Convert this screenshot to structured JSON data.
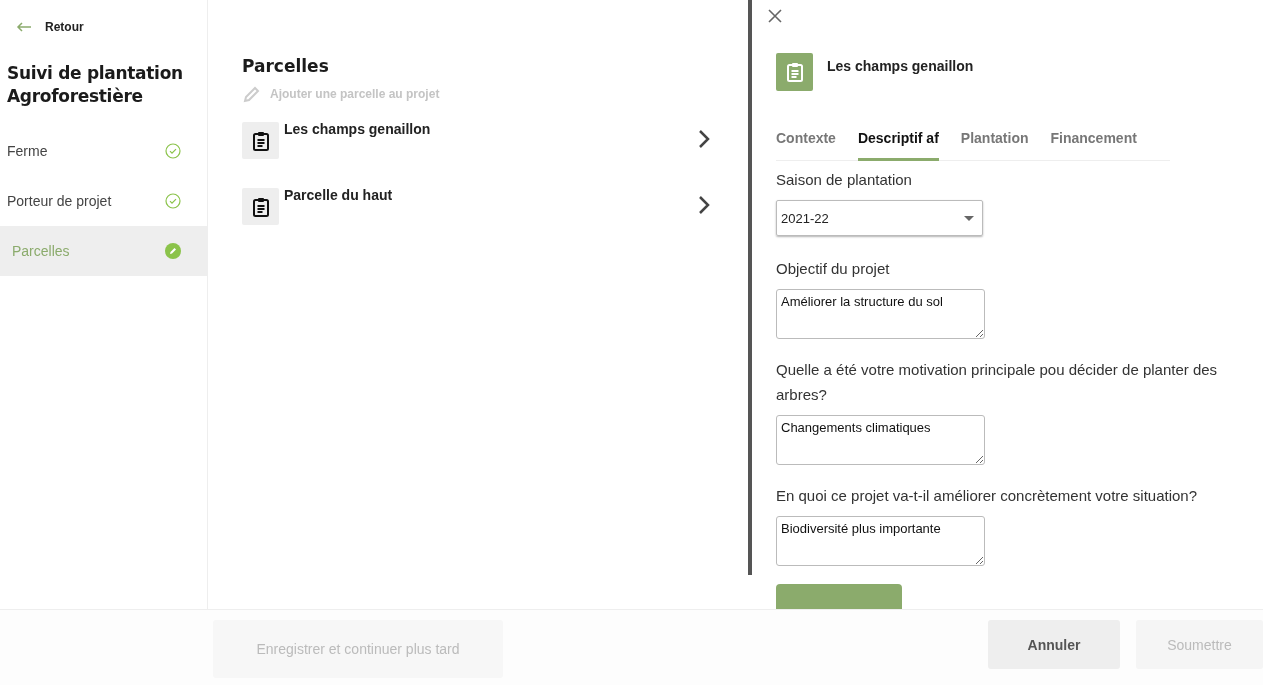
{
  "sidebar": {
    "back": "Retour",
    "title": "Suivi de plantation Agroforestière",
    "items": [
      {
        "label": "Ferme",
        "kind": "done",
        "selected": false
      },
      {
        "label": "Porteur de projet",
        "kind": "done",
        "selected": false
      },
      {
        "label": "Parcelles",
        "kind": "editing",
        "selected": true
      }
    ]
  },
  "parcels": {
    "title": "Parcelles",
    "add": "Ajouter une parcelle au projet",
    "items": [
      {
        "name": "Les champs genaillon"
      },
      {
        "name": "Parcelle du haut"
      }
    ]
  },
  "panel": {
    "title": "Les champs genaillon",
    "tabs": [
      {
        "label": "Contexte",
        "selected": false
      },
      {
        "label": "Descriptif af",
        "selected": true
      },
      {
        "label": "Plantation",
        "selected": false
      },
      {
        "label": "Financement",
        "selected": false
      }
    ],
    "fields": [
      {
        "kind": "select",
        "label": "Saison de plantation",
        "value": "2021-22"
      },
      {
        "kind": "textarea",
        "label": "Objectif du projet",
        "value": "Améliorer la structure du sol"
      },
      {
        "kind": "textarea",
        "label": "Quelle a été votre motivation principale pou décider de planter des arbres?",
        "value": "Changements climatiques"
      },
      {
        "kind": "textarea",
        "label": "En quoi ce projet va-t-il améliorer concrètement votre situation?",
        "value": "Biodiversité plus importante"
      }
    ]
  },
  "footer": {
    "buttons": [
      {
        "label": "Enregistrer et continuer plus tard",
        "disabled": true
      },
      {
        "label": "Annuler",
        "disabled": false
      },
      {
        "label": "Soumettre",
        "disabled": true
      }
    ]
  }
}
